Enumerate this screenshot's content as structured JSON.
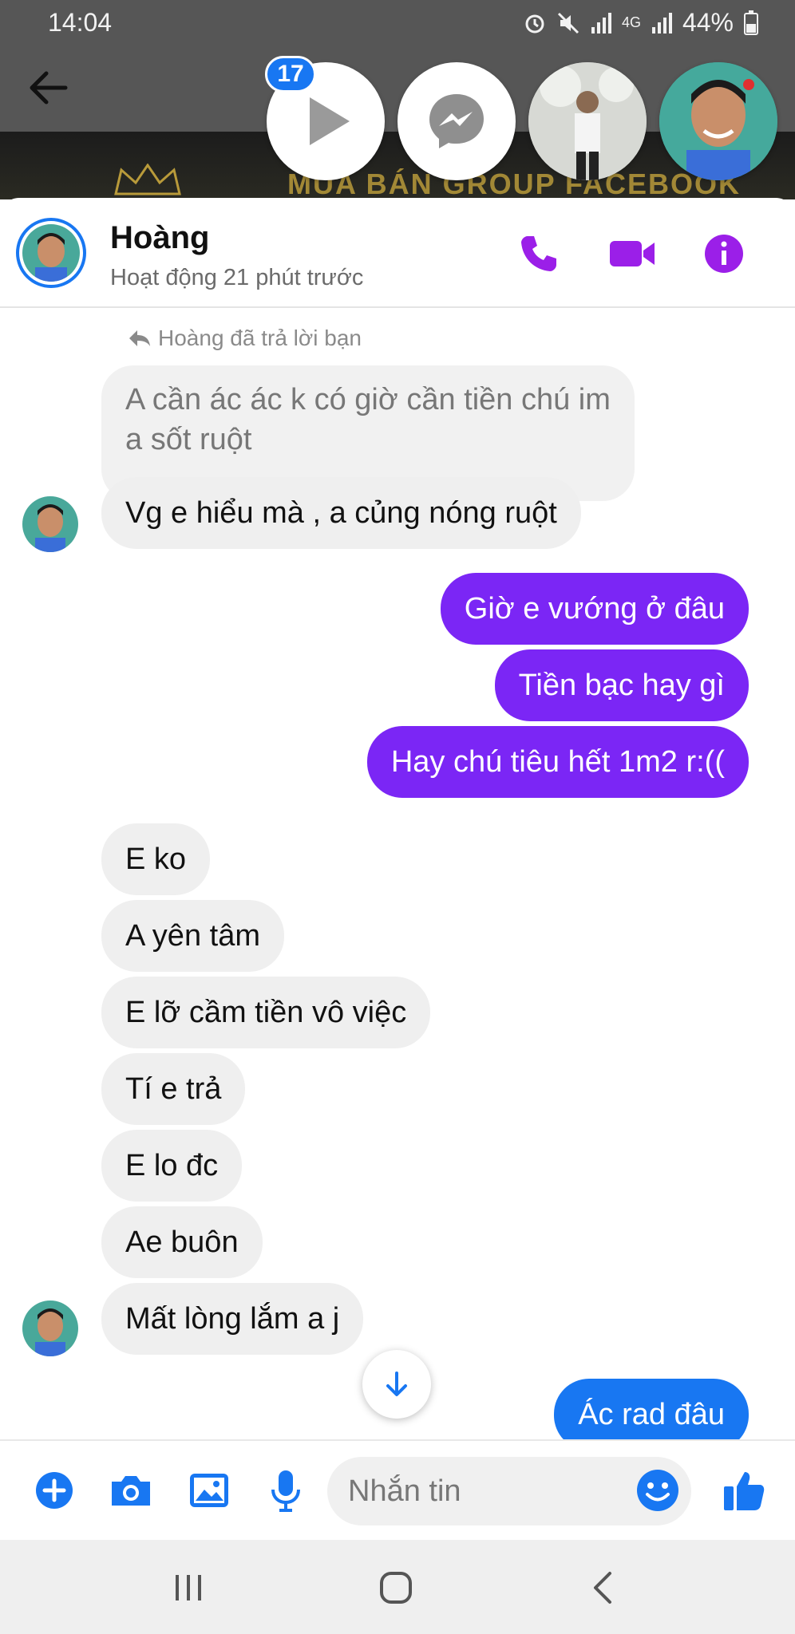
{
  "status_bar": {
    "time": "14:04",
    "battery": "44%",
    "network": "4G"
  },
  "chat_heads": {
    "badge_count": "17"
  },
  "banner": {
    "text": "MUA BÁN GROUP FACEBOOK"
  },
  "header": {
    "name": "Hoàng",
    "status": "Hoạt động 21 phút trước"
  },
  "reply_note": "Hoàng đã trả lời bạn",
  "quoted_message": "A cần ác ác k có giờ cần tiền chú im a sốt ruột",
  "messages": [
    {
      "side": "in",
      "text": "Vg e hiểu mà , a củng nóng ruột"
    },
    {
      "side": "out",
      "text": "Giờ e vướng ở đâu"
    },
    {
      "side": "out",
      "text": "Tiền bạc hay gì"
    },
    {
      "side": "out",
      "text": "Hay chú tiêu hết 1m2 r:(("
    },
    {
      "side": "in",
      "text": "E ko"
    },
    {
      "side": "in",
      "text": "A yên tâm"
    },
    {
      "side": "in",
      "text": "E lỡ cầm tiền vô việc"
    },
    {
      "side": "in",
      "text": "Tí e trả"
    },
    {
      "side": "in",
      "text": "E lo đc"
    },
    {
      "side": "in",
      "text": "Ae buôn"
    },
    {
      "side": "in",
      "text": "Mất lòng lắm a j"
    },
    {
      "side": "out",
      "text": "Ác rad đâu"
    }
  ],
  "composer": {
    "placeholder": "Nhắn tin"
  },
  "colors": {
    "outgoing": "#7b26f5",
    "accent": "#1877f2",
    "header_icons": "#9b1fe8"
  },
  "icons": [
    "back-arrow-icon",
    "play-icon",
    "messenger-icon",
    "phone-icon",
    "video-icon",
    "info-icon",
    "reply-icon",
    "arrow-down-icon",
    "plus-icon",
    "camera-icon",
    "image-icon",
    "microphone-icon",
    "emoji-icon",
    "thumbs-up-icon",
    "recents-icon",
    "home-icon",
    "nav-back-icon"
  ]
}
